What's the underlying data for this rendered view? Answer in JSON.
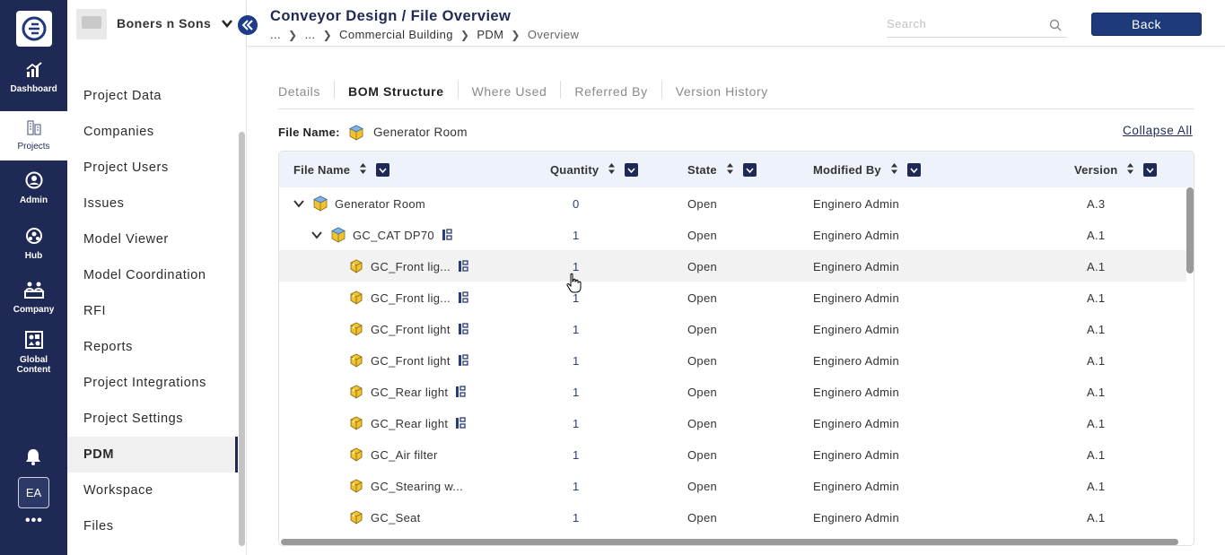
{
  "rail": {
    "items": [
      {
        "label": "Dashboard",
        "icon": "dashboard-icon"
      },
      {
        "label": "Projects",
        "icon": "projects-icon"
      },
      {
        "label": "Admin",
        "icon": "admin-icon"
      },
      {
        "label": "Hub",
        "icon": "hub-icon"
      },
      {
        "label": "Company",
        "icon": "company-icon"
      },
      {
        "label": "Global Content",
        "icon": "global-content-icon"
      }
    ],
    "active": "Projects",
    "avatar": "EA",
    "more": "•••"
  },
  "project": {
    "name": "Boners n Sons"
  },
  "sidebar": {
    "items": [
      {
        "label": "Project Data"
      },
      {
        "label": "Companies"
      },
      {
        "label": "Project Users"
      },
      {
        "label": "Issues"
      },
      {
        "label": "Model Viewer"
      },
      {
        "label": "Model Coordination"
      },
      {
        "label": "RFI"
      },
      {
        "label": "Reports"
      },
      {
        "label": "Project Integrations"
      },
      {
        "label": "Project Settings"
      },
      {
        "label": "PDM"
      },
      {
        "label": "Workspace"
      },
      {
        "label": "Files"
      }
    ],
    "active": "PDM"
  },
  "header": {
    "title": "Conveyor Design / File Overview",
    "breadcrumb": [
      "...",
      "...",
      "Commercial Building",
      "PDM",
      "Overview"
    ],
    "search_placeholder": "Search",
    "back_label": "Back"
  },
  "tabs": [
    {
      "label": "Details"
    },
    {
      "label": "BOM Structure"
    },
    {
      "label": "Where Used"
    },
    {
      "label": "Referred By"
    },
    {
      "label": "Version History"
    }
  ],
  "active_tab": "BOM Structure",
  "file": {
    "label": "File Name:",
    "value": "Generator Room",
    "collapse_all": "Collapse All"
  },
  "table": {
    "columns": [
      "File Name",
      "Quantity",
      "State",
      "Modified By",
      "Version"
    ],
    "rows": [
      {
        "name": "Generator Room",
        "level": 0,
        "type": "assembly",
        "expandable": true,
        "linked": false,
        "qty": "0",
        "state": "Open",
        "modified_by": "Enginero Admin",
        "version": "A.3"
      },
      {
        "name": "GC_CAT DP70",
        "level": 1,
        "type": "assembly",
        "expandable": true,
        "linked": true,
        "qty": "1",
        "state": "Open",
        "modified_by": "Enginero Admin",
        "version": "A.1"
      },
      {
        "name": "GC_Front lig...",
        "level": 2,
        "type": "part",
        "expandable": false,
        "linked": true,
        "qty": "1",
        "state": "Open",
        "modified_by": "Enginero Admin",
        "version": "A.1"
      },
      {
        "name": "GC_Front lig...",
        "level": 2,
        "type": "part",
        "expandable": false,
        "linked": true,
        "qty": "1",
        "state": "Open",
        "modified_by": "Enginero Admin",
        "version": "A.1"
      },
      {
        "name": "GC_Front light",
        "level": 2,
        "type": "part",
        "expandable": false,
        "linked": true,
        "qty": "1",
        "state": "Open",
        "modified_by": "Enginero Admin",
        "version": "A.1"
      },
      {
        "name": "GC_Front light",
        "level": 2,
        "type": "part",
        "expandable": false,
        "linked": true,
        "qty": "1",
        "state": "Open",
        "modified_by": "Enginero Admin",
        "version": "A.1"
      },
      {
        "name": "GC_Rear light",
        "level": 2,
        "type": "part",
        "expandable": false,
        "linked": true,
        "qty": "1",
        "state": "Open",
        "modified_by": "Enginero Admin",
        "version": "A.1"
      },
      {
        "name": "GC_Rear light",
        "level": 2,
        "type": "part",
        "expandable": false,
        "linked": true,
        "qty": "1",
        "state": "Open",
        "modified_by": "Enginero Admin",
        "version": "A.1"
      },
      {
        "name": "GC_Air filter",
        "level": 2,
        "type": "part",
        "expandable": false,
        "linked": false,
        "qty": "1",
        "state": "Open",
        "modified_by": "Enginero Admin",
        "version": "A.1"
      },
      {
        "name": "GC_Stearing w...",
        "level": 2,
        "type": "part",
        "expandable": false,
        "linked": false,
        "qty": "1",
        "state": "Open",
        "modified_by": "Enginero Admin",
        "version": "A.1"
      },
      {
        "name": "GC_Seat",
        "level": 2,
        "type": "part",
        "expandable": false,
        "linked": false,
        "qty": "1",
        "state": "Open",
        "modified_by": "Enginero Admin",
        "version": "A.1"
      }
    ],
    "hover_row": 2
  },
  "colors": {
    "rail_bg": "#1e2a55",
    "accent": "#1e3a7a",
    "header_bg": "#eef2fa",
    "part_icon": "#f2c230"
  }
}
